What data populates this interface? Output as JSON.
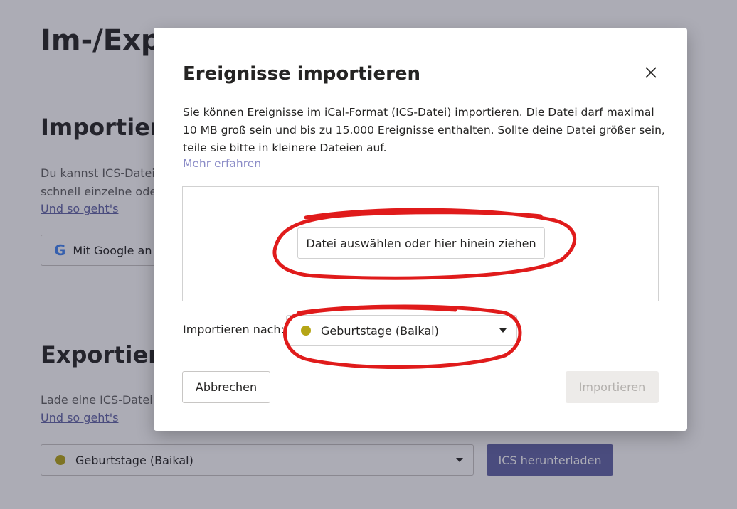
{
  "background": {
    "title": "Im-/Exp",
    "import_heading": "Importiere",
    "import_text_line1": "Du kannst ICS-Dateie",
    "import_text_line2": "schnell einzelne oder",
    "import_link": "Und so geht's",
    "google_button": "Mit Google an",
    "export_heading": "Exportiere",
    "export_text": "Lade eine ICS-Datei r",
    "export_link": "Und so geht's",
    "export_select_value": "Geburtstage (Baikal)",
    "download_button": "ICS herunterladen"
  },
  "dialog": {
    "title": "Ereignisse importieren",
    "description": "Sie können Ereignisse im iCal-Format (ICS-Datei) importieren. Die Datei darf maximal 10 MB groß sein und bis zu 15.000 Ereignisse enthalten. Sollte deine Datei größer sein, teile sie bitte in kleinere Dateien auf.",
    "more_link": "Mehr erfahren",
    "file_button": "Datei auswählen oder hier hinein ziehen",
    "import_to_label": "Importieren nach:",
    "import_to_value": "Geburtstage (Baikal)",
    "cancel_button": "Abbrechen",
    "import_button": "Importieren"
  },
  "colors": {
    "calendar_dot": "#b5a516",
    "accent": "#6264a7",
    "annotation": "#e01b1b"
  }
}
